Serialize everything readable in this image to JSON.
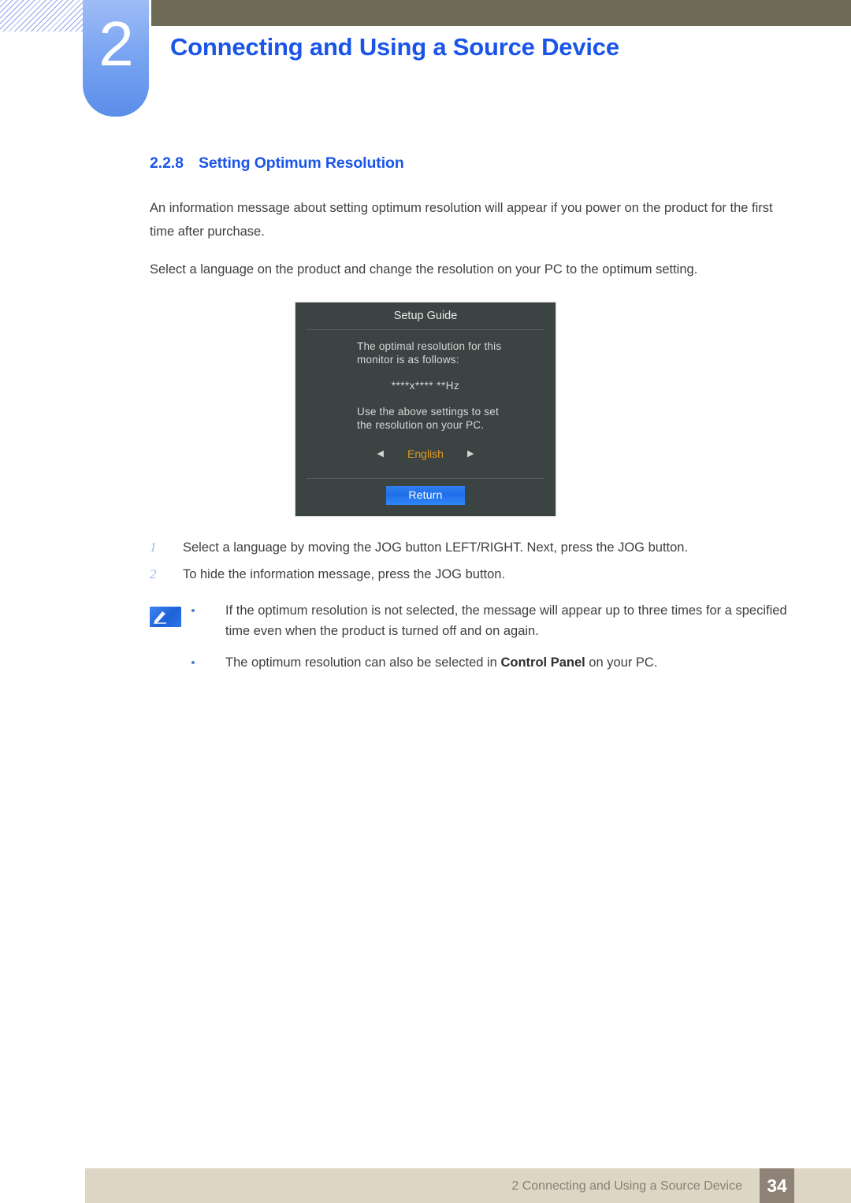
{
  "header": {
    "chapter_number": "2",
    "chapter_title": "Connecting and Using a Source Device",
    "accent_color": "#1a55e8",
    "bar_color": "#6d6a55",
    "badge_color": "#7ba5f2"
  },
  "section": {
    "number": "2.2.8",
    "title": "Setting Optimum Resolution",
    "paragraphs": [
      "An information message about setting optimum resolution will appear if you power on the product for the first time after purchase.",
      "Select a language on the product and change the resolution on your PC to the optimum setting."
    ]
  },
  "osd": {
    "title": "Setup Guide",
    "body_line_1": "The optimal resolution for this",
    "body_line_2": "monitor is as follows:",
    "resolution": "****x****  **Hz",
    "body_line_3": "Use the above settings to set",
    "body_line_4": "the resolution on your PC.",
    "language_left_arrow": "◀",
    "language_value": "English",
    "language_right_arrow": "▶",
    "return_label": "Return",
    "background_color": "#3b4343",
    "highlight_color": "#e09a21",
    "button_color": "#2f7ff0"
  },
  "steps": [
    {
      "num": "1",
      "text": "Select a language by moving the JOG button LEFT/RIGHT. Next, press the JOG button."
    },
    {
      "num": "2",
      "text": "To hide the information message, press the JOG button."
    }
  ],
  "notes": {
    "icon": "note-pen-icon",
    "items": [
      {
        "prefix": "If the optimum resolution is not selected, the message will appear up to three times for a specified time even when the product is turned off and on again.",
        "bold": "",
        "suffix": ""
      },
      {
        "prefix": "The optimum resolution can also be selected in ",
        "bold": "Control Panel",
        "suffix": " on your PC."
      }
    ]
  },
  "footer": {
    "text": "2 Connecting and Using a Source Device",
    "page_number": "34",
    "bar_color": "#ddd6c4",
    "page_box_color": "#8f8276"
  }
}
